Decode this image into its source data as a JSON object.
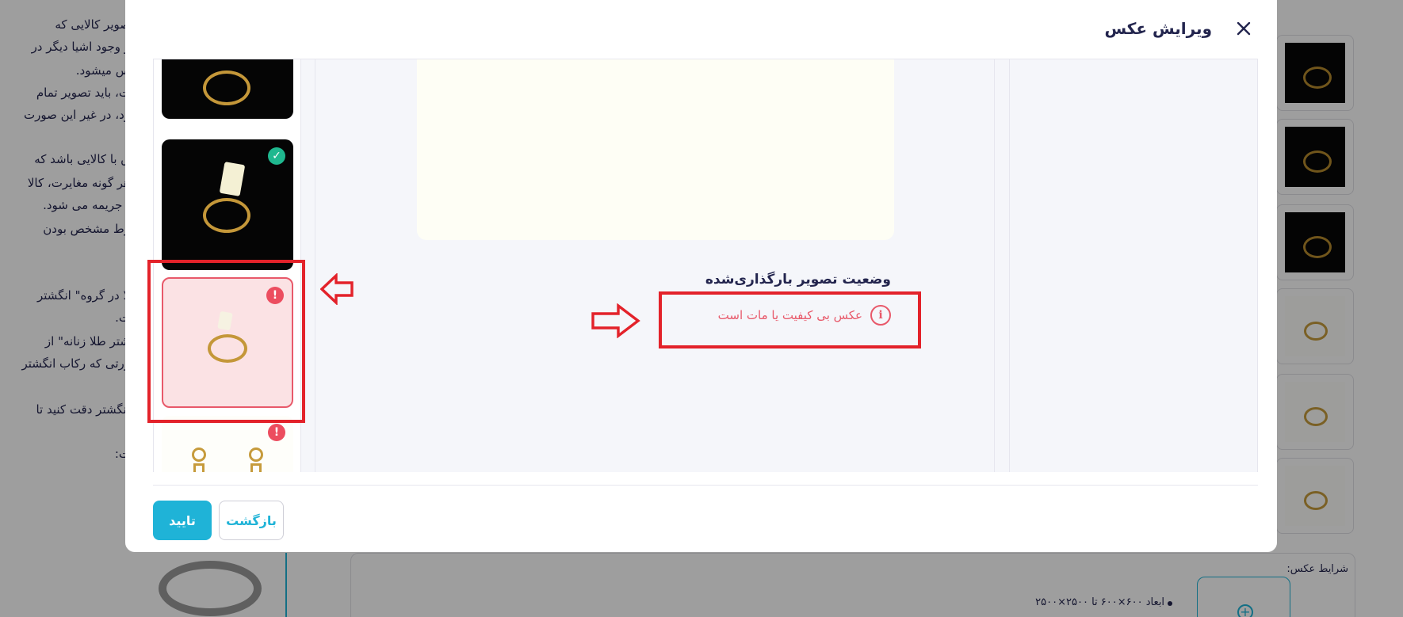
{
  "modal": {
    "title": "ویرایش عکس",
    "status_title": "وضعیت تصویر بارگذاری‌شده",
    "status_message": "عکس بی کیفیت یا مات است",
    "confirm_label": "تایید",
    "back_label": "بازگشت"
  },
  "thumbnails": [
    {
      "state": "none",
      "style": "dark"
    },
    {
      "state": "ok",
      "badge": "✓",
      "style": "dark"
    },
    {
      "state": "error",
      "badge": "!",
      "style": "selected"
    },
    {
      "state": "error",
      "badge": "!",
      "style": "light"
    }
  ],
  "background": {
    "text_lines": [
      "صویر کالایی که",
      "و وجود اشیا دیگر در",
      "س میشود.",
      "ت، باید تصویر تمام",
      "ود، در غیر این صورت",
      "ق با کالایی باشد که",
      "هر گونه مغایرت، کالا",
      "، جریمه می شود.",
      "رط مشخص بودن",
      "لا در  گروه\" انگشتر",
      "ت.",
      "شتر طلا زنانه\"  از",
      "ورتی که رکاب انگشتر",
      " انگشتر دقت کنید تا",
      "ت:"
    ],
    "conditions_title": "شرایط عکس:",
    "conditions_item": "ابعاد ۶۰۰×۶۰۰ تا ۲۵۰۰×۲۵۰۰"
  },
  "icons": {
    "close": "close-icon",
    "info": "info-icon",
    "check": "check-icon",
    "alert": "alert-icon",
    "plus": "plus-circle-icon"
  },
  "colors": {
    "accent": "#1fb3d7",
    "error": "#e8596a",
    "success": "#1fb88f",
    "annotation": "#e3222a"
  }
}
